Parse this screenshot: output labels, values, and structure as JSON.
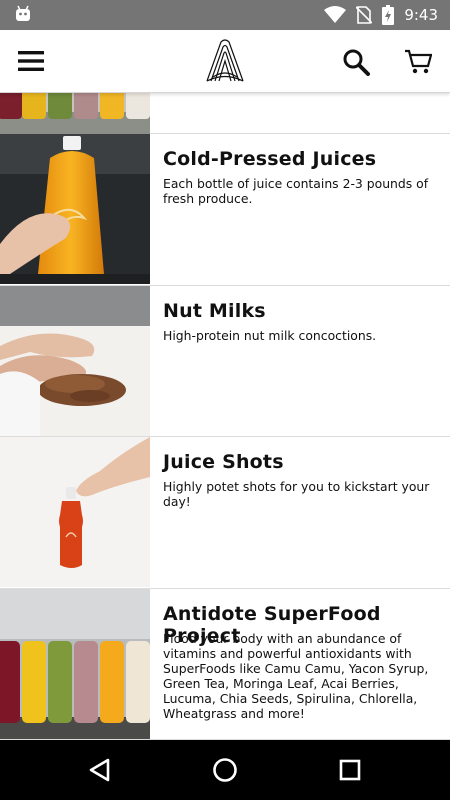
{
  "status_bar": {
    "time": "9:43",
    "icons": [
      "android-icon",
      "wifi-icon",
      "no-sim-icon",
      "battery-charging-icon"
    ]
  },
  "app_bar": {
    "icons": [
      "menu-icon",
      "antidote-logo",
      "search-icon",
      "cart-icon"
    ]
  },
  "categories": [
    {
      "title": "Cold-Pressed Juices",
      "description": "Each bottle of juice contains 2-3 pounds of fresh produce."
    },
    {
      "title": "Nut Milks",
      "description": "High-protein nut milk concoctions."
    },
    {
      "title": "Juice Shots",
      "description": "Highly potet shots for you to kickstart your day!"
    },
    {
      "title": "Antidote SuperFood Project",
      "description": "Flood your body with an abundance of vitamins and powerful antioxidants with SuperFoods like Camu Camu, Yacon Syrup, Green Tea, Moringa Leaf, Acai Berries, Lucuma, Chia Seeds, Spirulina, Chlorella, Wheatgrass and more!"
    }
  ],
  "nav_bar": {
    "icons": [
      "back-icon",
      "home-icon",
      "recents-icon"
    ]
  }
}
